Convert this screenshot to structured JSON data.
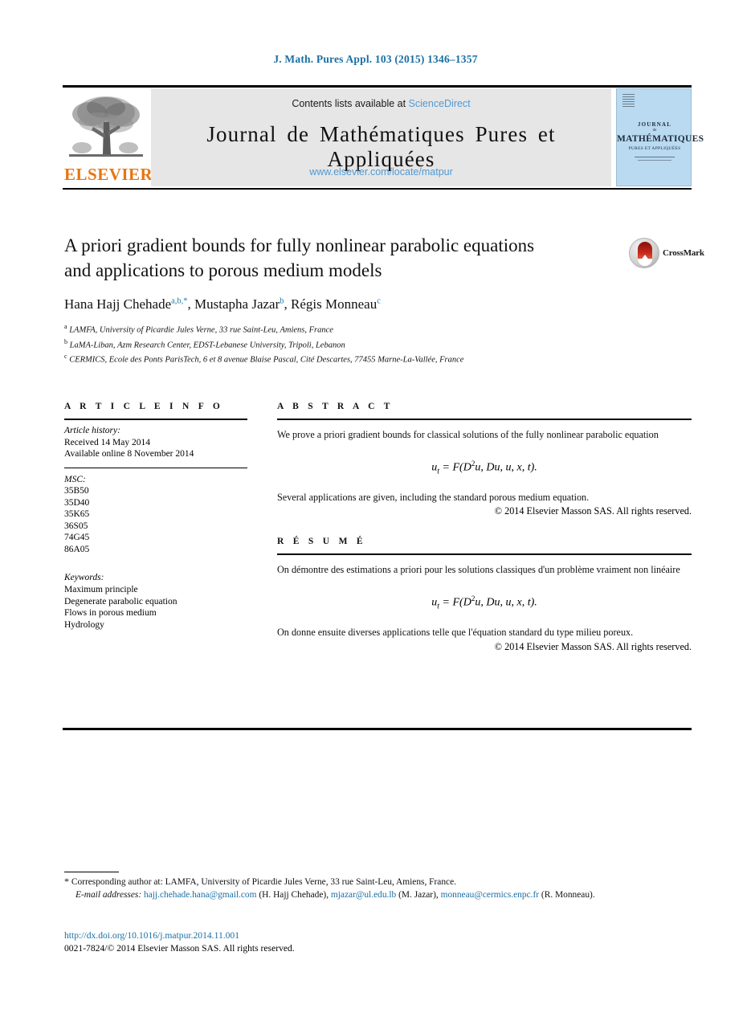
{
  "running_head": "J. Math. Pures Appl. 103 (2015) 1346–1357",
  "masthead": {
    "contents_prefix": "Contents lists available at ",
    "sciencedirect": "ScienceDirect",
    "journal_title": "Journal de Mathématiques Pures et Appliquées",
    "journal_url": "www.elsevier.com/locate/matpur",
    "publisher_wordmark": "ELSEVIER",
    "cover": {
      "line_journal": "JOURNAL",
      "line_de": "de",
      "line_math": "MATHÉMATIQUES",
      "line_sub": "PURES ET APPLIQUÉES"
    }
  },
  "crossmark": {
    "label": "CrossMark"
  },
  "article": {
    "title_line1": "A priori gradient bounds for fully nonlinear parabolic equations",
    "title_line2": "and applications to porous medium models",
    "authors": [
      {
        "name": "Hana Hajj Chehade",
        "sup": "a,b,*"
      },
      {
        "name": "Mustapha Jazar",
        "sup": "b"
      },
      {
        "name": "Régis Monneau",
        "sup": "c"
      }
    ],
    "affiliations": [
      {
        "mark": "a",
        "text": "LAMFA, University of Picardie Jules Verne, 33 rue Saint-Leu, Amiens, France"
      },
      {
        "mark": "b",
        "text": "LaMA-Liban, Azm Research Center, EDST-Lebanese University, Tripoli, Lebanon"
      },
      {
        "mark": "c",
        "text": "CERMICS, Ecole des Ponts ParisTech, 6 et 8 avenue Blaise Pascal, Cité Descartes, 77455 Marne-La-Vallée, France"
      }
    ]
  },
  "info": {
    "heading": "A R T I C L E   I N F O",
    "history_label": "Article history:",
    "history": [
      "Received 14 May 2014",
      "Available online 8 November 2014"
    ],
    "msc_label": "MSC:",
    "msc": [
      "35B50",
      "35D40",
      "35K65",
      "36S05",
      "74G45",
      "86A05"
    ],
    "keywords_label": "Keywords:",
    "keywords": [
      "Maximum principle",
      "Degenerate parabolic equation",
      "Flows in porous medium",
      "Hydrology"
    ]
  },
  "abstract": {
    "heading": "A B S T R A C T",
    "para1": "We prove a priori gradient bounds for classical solutions of the fully nonlinear parabolic equation",
    "equation": "ut = F(D2u, Du, u, x, t).",
    "para2": "Several applications are given, including the standard porous medium equation.",
    "copyright": "© 2014 Elsevier Masson SAS. All rights reserved."
  },
  "resume": {
    "heading": "R É S U M É",
    "para1": "On démontre des estimations a priori pour les solutions classiques d'un problème vraiment non linéaire",
    "equation": "ut = F(D2u, Du, u, x, t).",
    "para2": "On donne ensuite diverses applications telle que l'équation standard du type milieu poreux.",
    "copyright": "© 2014 Elsevier Masson SAS. All rights reserved."
  },
  "footnotes": {
    "corresponding": "Corresponding author at: LAMFA, University of Picardie Jules Verne, 33 rue Saint-Leu, Amiens, France.",
    "email_label": "E-mail addresses:",
    "emails": [
      {
        "address": "hajj.chehade.hana@gmail.com",
        "owner": "(H. Hajj Chehade)"
      },
      {
        "address": "mjazar@ul.edu.lb",
        "owner": "(M. Jazar)"
      },
      {
        "address": "monneau@cermics.enpc.fr",
        "owner": "(R. Monneau)."
      }
    ]
  },
  "doi": {
    "url": "http://dx.doi.org/10.1016/j.matpur.2014.11.001",
    "issn_line": "0021-7824/© 2014 Elsevier Masson SAS. All rights reserved."
  },
  "colors": {
    "link": "#1a6fa3",
    "sciencedirect": "#4f9ad4",
    "elsevier_orange": "#e87511",
    "masthead_bg": "#e6e6e6",
    "cover_bg": "#b9daf0"
  }
}
